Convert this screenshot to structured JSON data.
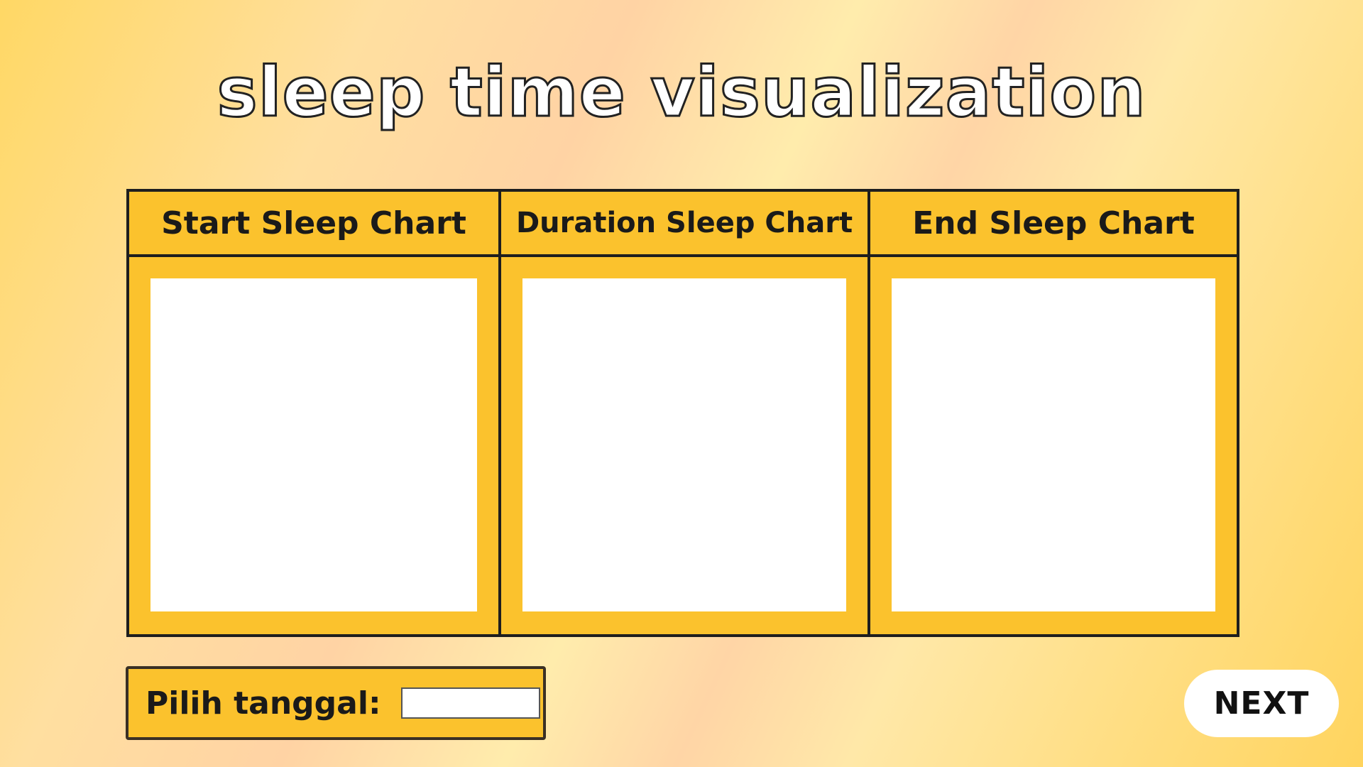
{
  "page": {
    "title": "sleep time visualization"
  },
  "charts": [
    {
      "label": "Start Sleep Chart"
    },
    {
      "label": "Duration Sleep Chart"
    },
    {
      "label": "End Sleep Chart"
    }
  ],
  "date_picker": {
    "label": "Pilih tanggal:",
    "value": ""
  },
  "next_button": {
    "label": "NEXT"
  },
  "colors": {
    "panel": "#fbc22d",
    "border": "#1e1e1e",
    "canvas": "#ffffff",
    "title_fill": "#ffffff",
    "title_stroke": "#222222"
  }
}
